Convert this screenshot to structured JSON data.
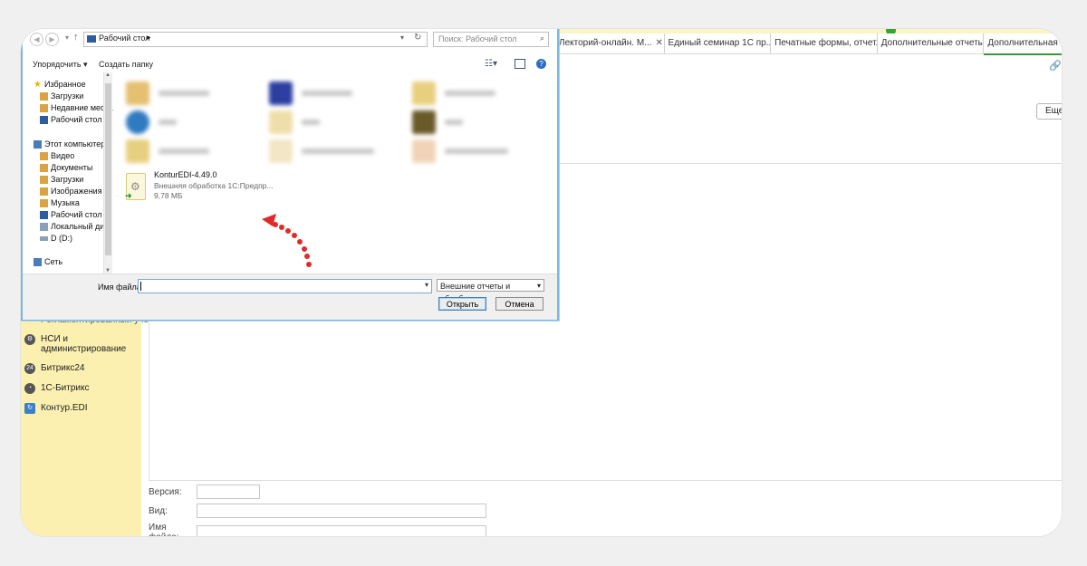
{
  "dialog": {
    "address": {
      "location": "Рабочий стол"
    },
    "search": {
      "placeholder": "Поиск: Рабочий стол"
    },
    "toolbar": {
      "organize_label": "Упорядочить ▾",
      "new_folder_label": "Создать папку"
    },
    "tree": {
      "items": [
        {
          "label": "Избранное",
          "icon": "star-icon",
          "color": "#e8b800"
        },
        {
          "label": "Загрузки",
          "icon": "folder-icon",
          "color": "#d9a441"
        },
        {
          "label": "Недавние места",
          "icon": "folder-icon",
          "color": "#d9a441"
        },
        {
          "label": "Рабочий стол",
          "icon": "desktop-icon",
          "color": "#2d5d9f"
        },
        {
          "label": "Этот компьютер",
          "icon": "computer-icon",
          "color": "#4a7db8"
        },
        {
          "label": "Видео",
          "icon": "folder-icon",
          "color": "#d9a441"
        },
        {
          "label": "Документы",
          "icon": "folder-icon",
          "color": "#d9a441"
        },
        {
          "label": "Загрузки",
          "icon": "folder-icon",
          "color": "#d9a441"
        },
        {
          "label": "Изображения",
          "icon": "folder-icon",
          "color": "#d9a441"
        },
        {
          "label": "Музыка",
          "icon": "folder-icon",
          "color": "#d9a441"
        },
        {
          "label": "Рабочий стол",
          "icon": "desktop-icon",
          "color": "#2d5d9f"
        },
        {
          "label": "Локальный диск",
          "icon": "drive-icon",
          "color": "#8aa0b8"
        },
        {
          "label": "D (D:)",
          "icon": "drive-icon",
          "color": "#8aa0b8"
        },
        {
          "label": "Сеть",
          "icon": "network-icon",
          "color": "#4a7db8"
        }
      ]
    },
    "file": {
      "name": "KonturEDI-4.49.0",
      "type": "Внешняя обработка 1С:Предпр...",
      "size": "9,78 МБ"
    },
    "footer": {
      "filename_label": "Имя файла:",
      "filename_value": "",
      "filter": "Внешние отчеты и обработки",
      "open_label": "Открыть",
      "cancel_label": "Отмена"
    }
  },
  "app": {
    "tabs": [
      {
        "label": "Лекторий-онлайн. М...",
        "active": false
      },
      {
        "label": "Единый семинар 1С пр...",
        "active": false
      },
      {
        "label": "Печатные формы, отчет...",
        "active": false
      },
      {
        "label": "Дополнительные отчеты...",
        "active": false
      },
      {
        "label": "Дополнительная об...",
        "active": true
      }
    ],
    "more_label": "Еще",
    "sidebar": {
      "cut_label": "Регламентированный учет",
      "items": [
        {
          "label": "НСИ и администрирование",
          "icon": "gear-icon"
        },
        {
          "label": "Битрикс24",
          "icon": "bitrix24-icon"
        },
        {
          "label": "1С-Битрикс",
          "icon": "bitrix-icon"
        },
        {
          "label": "Контур.EDI",
          "icon": "kontur-edi-icon"
        }
      ]
    },
    "form": {
      "version_label": "Версия:",
      "kind_label": "Вид:",
      "filename_label": "Имя файла:"
    }
  },
  "colors": {
    "sidebar_bg": "#fbf0b0",
    "dialog_border": "#7ab8e0",
    "annotation_arrow": "#e02a2a"
  }
}
